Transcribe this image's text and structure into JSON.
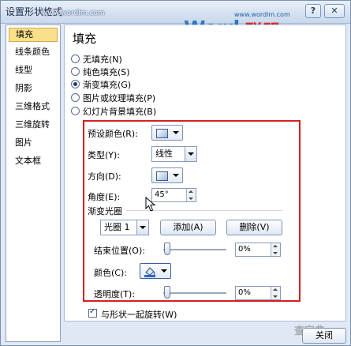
{
  "window": {
    "title": "设置形状格式",
    "title_overlay": "www.wordlm.com"
  },
  "logo": {
    "url": "www.wordlm.com",
    "word": "Word",
    "cn": "联盟"
  },
  "controls": {
    "help": "?",
    "close_x": "✕"
  },
  "nav": {
    "items": [
      {
        "label": "填充",
        "selected": true
      },
      {
        "label": "线条颜色",
        "selected": false
      },
      {
        "label": "线型",
        "selected": false
      },
      {
        "label": "阴影",
        "selected": false
      },
      {
        "label": "三维格式",
        "selected": false
      },
      {
        "label": "三维旋转",
        "selected": false
      },
      {
        "label": "图片",
        "selected": false
      },
      {
        "label": "文本框",
        "selected": false
      }
    ]
  },
  "fill": {
    "title": "填充",
    "options": [
      {
        "label": "无填充(N)",
        "checked": false
      },
      {
        "label": "纯色填充(S)",
        "checked": false
      },
      {
        "label": "渐变填充(G)",
        "checked": true
      },
      {
        "label": "图片或纹理填充(P)",
        "checked": false
      },
      {
        "label": "幻灯片背景填充(B)",
        "checked": false
      }
    ],
    "preset_label": "预设颜色(R):",
    "type_label": "类型(Y):",
    "type_value": "线性",
    "direction_label": "方向(D):",
    "angle_label": "角度(E):",
    "angle_value": "45°",
    "stops_label": "渐变光圈",
    "stop_value": "光圈 1",
    "add_label": "添加(A)",
    "delete_label": "删除(V)",
    "end_pos_label": "结束位置(O):",
    "end_pos_value": "0%",
    "end_pos_fraction": 0,
    "color_label": "颜色(C):",
    "transparency_label": "透明度(T):",
    "transparency_value": "0%",
    "transparency_fraction": 0,
    "rotate_label": "与形状一起旋转(W)",
    "rotate_checked": true
  },
  "footer": {
    "close_label": "关闭",
    "watermark": "查字典"
  },
  "colors": {
    "highlight_frame": "#d42020",
    "nav_selected": "#f9e08a",
    "logo_word": "#2b78c8",
    "logo_cn": "#d52a1e"
  }
}
